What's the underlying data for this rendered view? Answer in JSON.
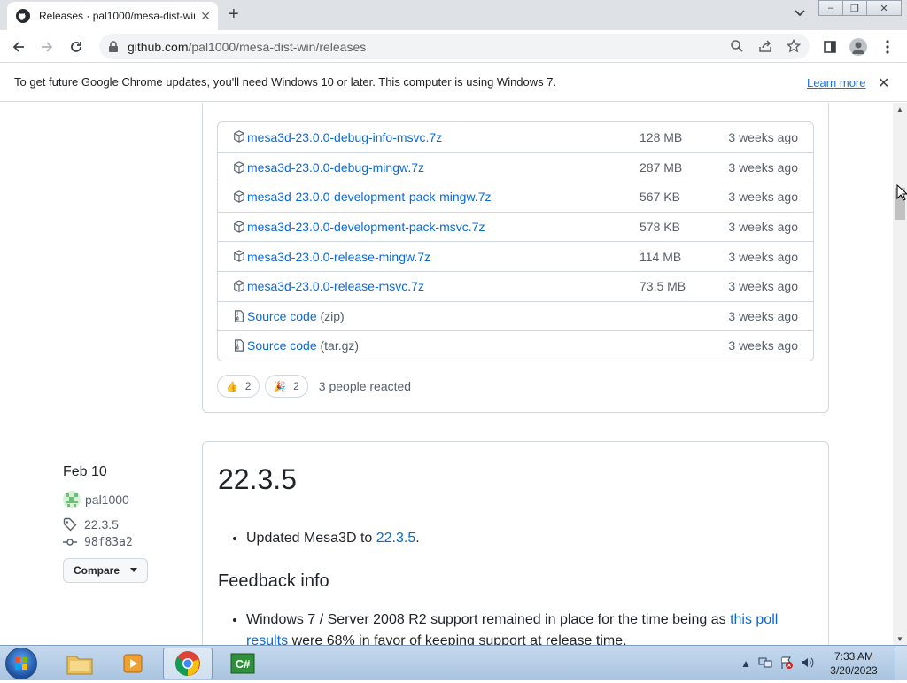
{
  "browser": {
    "tab": {
      "title": "Releases · pal1000/mesa-dist-win",
      "close": "✕"
    },
    "new_tab": "+",
    "url": {
      "host": "github.com",
      "path": "/pal1000/mesa-dist-win/releases"
    },
    "window_buttons": {
      "minimize": "–",
      "maximize": "❐",
      "close": "✕"
    }
  },
  "infobar": {
    "message": "To get future Google Chrome updates, you'll need Windows 10 or later. This computer is using Windows 7.",
    "link": "Learn more",
    "close": "✕"
  },
  "assets": [
    {
      "name": "mesa3d-23.0.0-debug-info-msvc.7z",
      "size": "128 MB",
      "when": "3 weeks ago",
      "icon": "package-icon"
    },
    {
      "name": "mesa3d-23.0.0-debug-mingw.7z",
      "size": "287 MB",
      "when": "3 weeks ago",
      "icon": "package-icon"
    },
    {
      "name": "mesa3d-23.0.0-development-pack-mingw.7z",
      "size": "567 KB",
      "when": "3 weeks ago",
      "icon": "package-icon"
    },
    {
      "name": "mesa3d-23.0.0-development-pack-msvc.7z",
      "size": "578 KB",
      "when": "3 weeks ago",
      "icon": "package-icon"
    },
    {
      "name": "mesa3d-23.0.0-release-mingw.7z",
      "size": "114 MB",
      "when": "3 weeks ago",
      "icon": "package-icon"
    },
    {
      "name": "mesa3d-23.0.0-release-msvc.7z",
      "size": "73.5 MB",
      "when": "3 weeks ago",
      "icon": "package-icon"
    },
    {
      "name": "Source code",
      "suffix": "(zip)",
      "size": "",
      "when": "3 weeks ago",
      "icon": "file-zip-icon"
    },
    {
      "name": "Source code",
      "suffix": "(tar.gz)",
      "size": "",
      "when": "3 weeks ago",
      "icon": "file-zip-icon"
    }
  ],
  "reactions": {
    "items": [
      {
        "emoji": "👍",
        "count": "2"
      },
      {
        "emoji": "🎉",
        "count": "2"
      }
    ],
    "summary": "3 people reacted"
  },
  "release": {
    "date": "Feb 10",
    "author": "pal1000",
    "tag": "22.3.5",
    "commit": "98f83a2",
    "compare": "Compare",
    "version": "22.3.5",
    "bullet1_prefix": "Updated Mesa3D to ",
    "bullet1_link": "22.3.5",
    "bullet1_suffix": ".",
    "heading": "Feedback info",
    "bullet2_prefix": "Windows 7 / Server 2008 R2 support remained in place for the time being as ",
    "bullet2_link": "this poll results",
    "bullet2_suffix": " were 68% in favor of keeping support at release time."
  },
  "taskbar": {
    "time": "7:33 AM",
    "date": "3/20/2023"
  }
}
